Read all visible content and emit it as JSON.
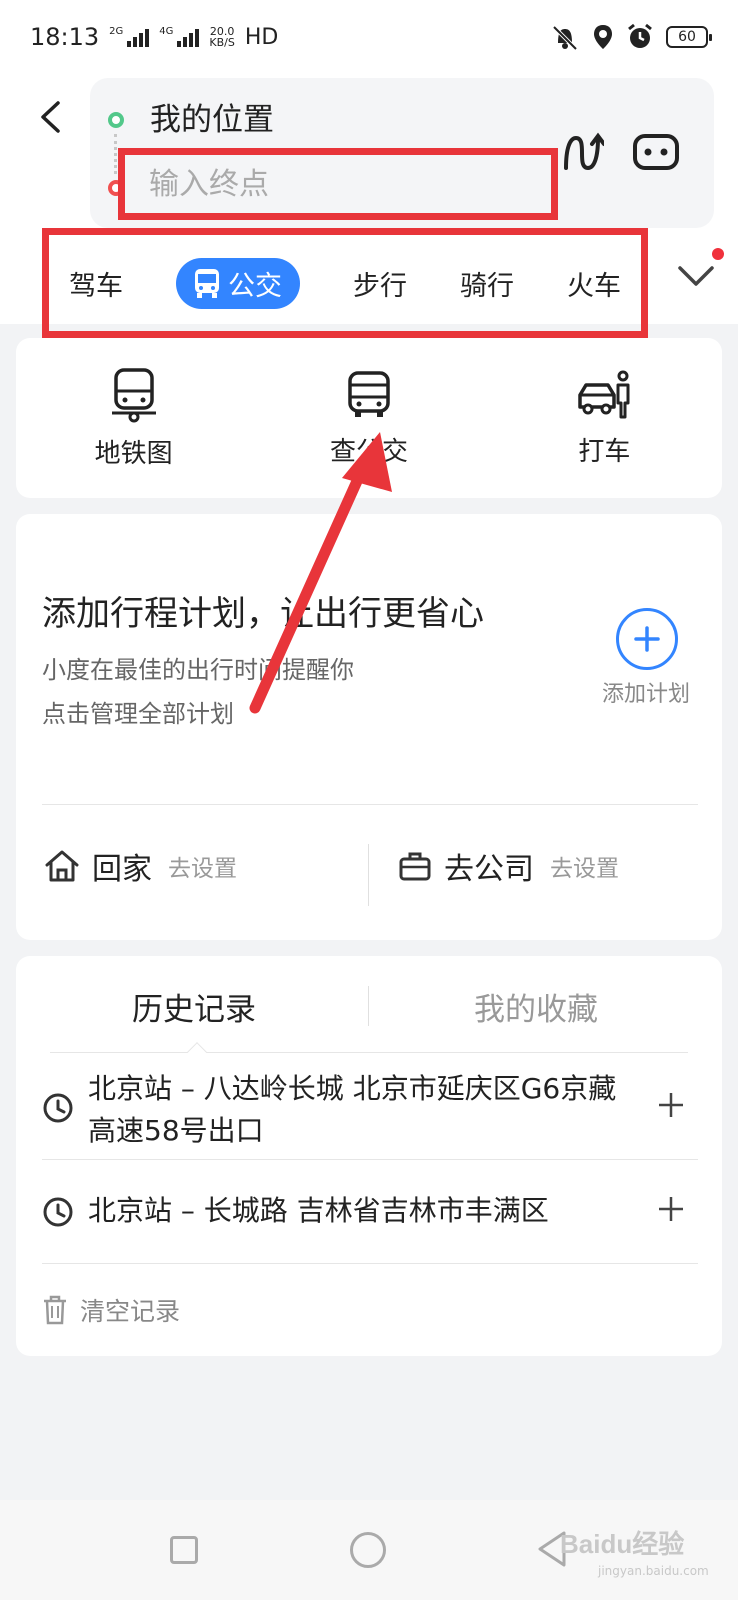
{
  "status": {
    "time": "18:13",
    "sim1_tag": "2G",
    "sim2_tag": "4G",
    "speed_value": "20.0",
    "speed_unit": "KB/S",
    "hd_label": "HD",
    "battery": "60"
  },
  "route": {
    "start": "我的位置",
    "end_placeholder": "输入终点"
  },
  "modes": [
    "驾车",
    "公交",
    "步行",
    "骑行",
    "火车"
  ],
  "quick_actions": [
    "地铁图",
    "查公交",
    "打车"
  ],
  "plan": {
    "title": "添加行程计划，让出行更省心",
    "subtitle1": "小度在最佳的出行时间提醒你",
    "subtitle2": "点击管理全部计划",
    "add_label": "添加计划"
  },
  "shortcuts": {
    "home": "回家",
    "home_action": "去设置",
    "work": "去公司",
    "work_action": "去设置"
  },
  "history": {
    "tab_history": "历史记录",
    "tab_favorites": "我的收藏",
    "items": [
      "北京站 – 八达岭长城 北京市延庆区G6京藏高速58号出口",
      "北京站 – 长城路 吉林省吉林市丰满区"
    ],
    "clear_label": "清空记录"
  },
  "watermark": {
    "brand": "Baidu经验",
    "url": "jingyan.baidu.com"
  },
  "colors": {
    "accent": "#3385ff",
    "annotation": "#e8353a",
    "start_dot": "#52c88a"
  }
}
